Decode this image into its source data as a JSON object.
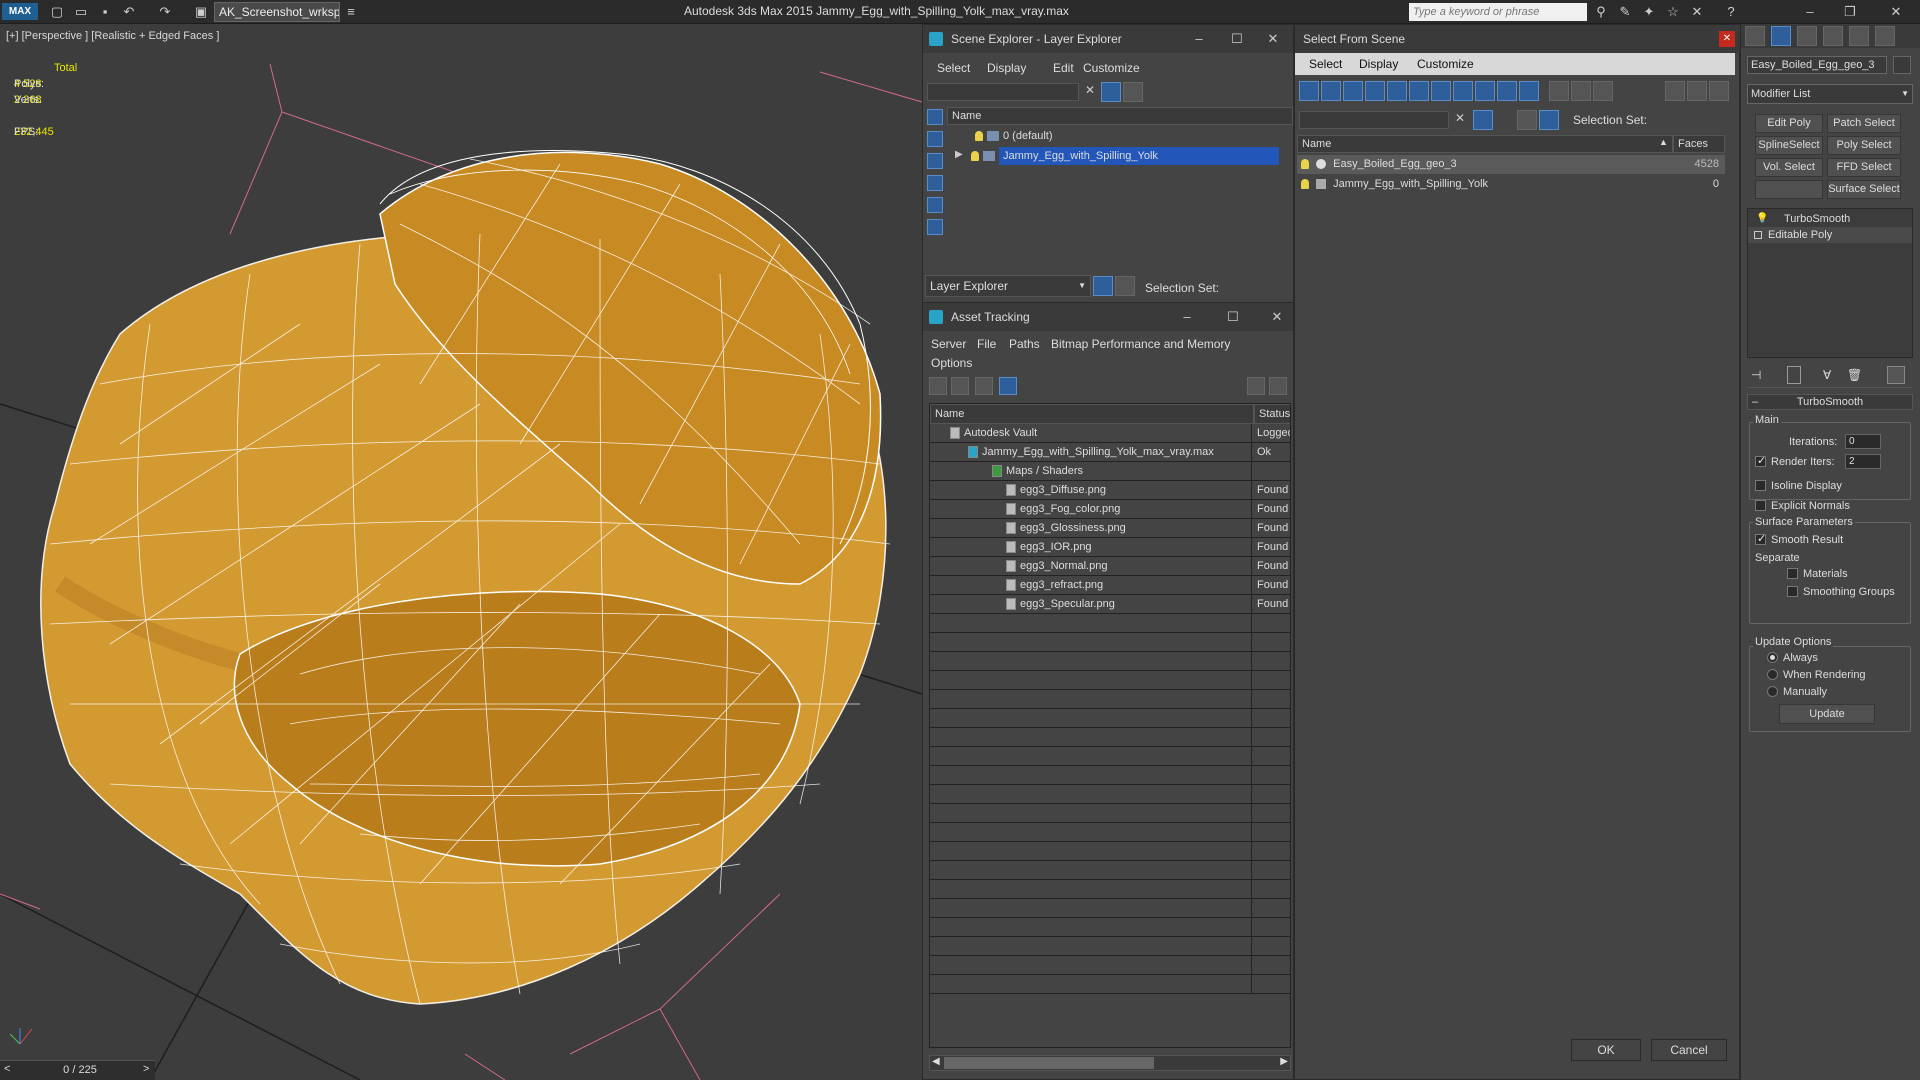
{
  "titlebar": {
    "workspace": "AK_Screenshot_wrksp",
    "app_title": "Autodesk 3ds Max  2015    Jammy_Egg_with_Spilling_Yolk_max_vray.max",
    "search_placeholder": "Type a keyword or phrase"
  },
  "viewport": {
    "label": "[+] [Perspective ] [Realistic + Edged Faces ]",
    "stats": {
      "header": "Total",
      "polys_label": "Polys:",
      "polys_value": "4 528",
      "verts_label": "Verts:",
      "verts_value": "2 268",
      "fps_label": "FPS:",
      "fps_value": "232,445"
    },
    "time_slider": "0 / 225"
  },
  "scene_explorer": {
    "title": "Scene Explorer - Layer Explorer",
    "menu": [
      "Select",
      "Display",
      "Edit",
      "Customize"
    ],
    "col_name": "Name",
    "rows": [
      "0 (default)",
      "Jammy_Egg_with_Spilling_Yolk"
    ],
    "explorer_dropdown": "Layer Explorer",
    "selection_set": "Selection Set:"
  },
  "asset_tracking": {
    "title": "Asset Tracking",
    "menu": [
      "Server",
      "File",
      "Paths",
      "Bitmap Performance and Memory",
      "Options"
    ],
    "col_name": "Name",
    "col_status": "Status",
    "rows": [
      {
        "name": "Autodesk Vault",
        "status": "Logged"
      },
      {
        "name": "Jammy_Egg_with_Spilling_Yolk_max_vray.max",
        "status": "Ok"
      },
      {
        "name": "Maps / Shaders",
        "status": ""
      },
      {
        "name": "egg3_Diffuse.png",
        "status": "Found"
      },
      {
        "name": "egg3_Fog_color.png",
        "status": "Found"
      },
      {
        "name": "egg3_Glossiness.png",
        "status": "Found"
      },
      {
        "name": "egg3_IOR.png",
        "status": "Found"
      },
      {
        "name": "egg3_Normal.png",
        "status": "Found"
      },
      {
        "name": "egg3_refract.png",
        "status": "Found"
      },
      {
        "name": "egg3_Specular.png",
        "status": "Found"
      }
    ]
  },
  "select_from_scene": {
    "title": "Select From Scene",
    "menu": [
      "Select",
      "Display",
      "Customize"
    ],
    "selection_set": "Selection Set:",
    "col_name": "Name",
    "col_faces": "Faces",
    "rows": [
      {
        "name": "Easy_Boiled_Egg_geo_3",
        "faces": "4528"
      },
      {
        "name": "Jammy_Egg_with_Spilling_Yolk",
        "faces": "0"
      }
    ],
    "ok": "OK",
    "cancel": "Cancel"
  },
  "command_panel": {
    "object_name": "Easy_Boiled_Egg_geo_3",
    "modifier_list": "Modifier List",
    "buttons": [
      "Edit Poly",
      "Patch Select",
      "SplineSelect",
      "Poly Select",
      "Vol. Select",
      "FFD Select",
      "Surface Select"
    ],
    "stack": [
      "TurboSmooth",
      "Editable Poly"
    ],
    "rollout_title": "TurboSmooth",
    "main_label": "Main",
    "iterations_label": "Iterations:",
    "iterations_value": "0",
    "render_iters_label": "Render Iters:",
    "render_iters_value": "2",
    "isoline_display": "Isoline Display",
    "explicit_normals": "Explicit Normals",
    "surface_params": "Surface Parameters",
    "smooth_result": "Smooth Result",
    "separate": "Separate",
    "materials": "Materials",
    "smoothing_groups": "Smoothing Groups",
    "update_options": "Update Options",
    "always": "Always",
    "when_rendering": "When Rendering",
    "manually": "Manually",
    "update": "Update"
  },
  "colors": {
    "selection_blue": "#2256b8",
    "egg_orange": "#d99a2c",
    "wire_white": "#ffffff",
    "close_red": "#c42b1c"
  }
}
